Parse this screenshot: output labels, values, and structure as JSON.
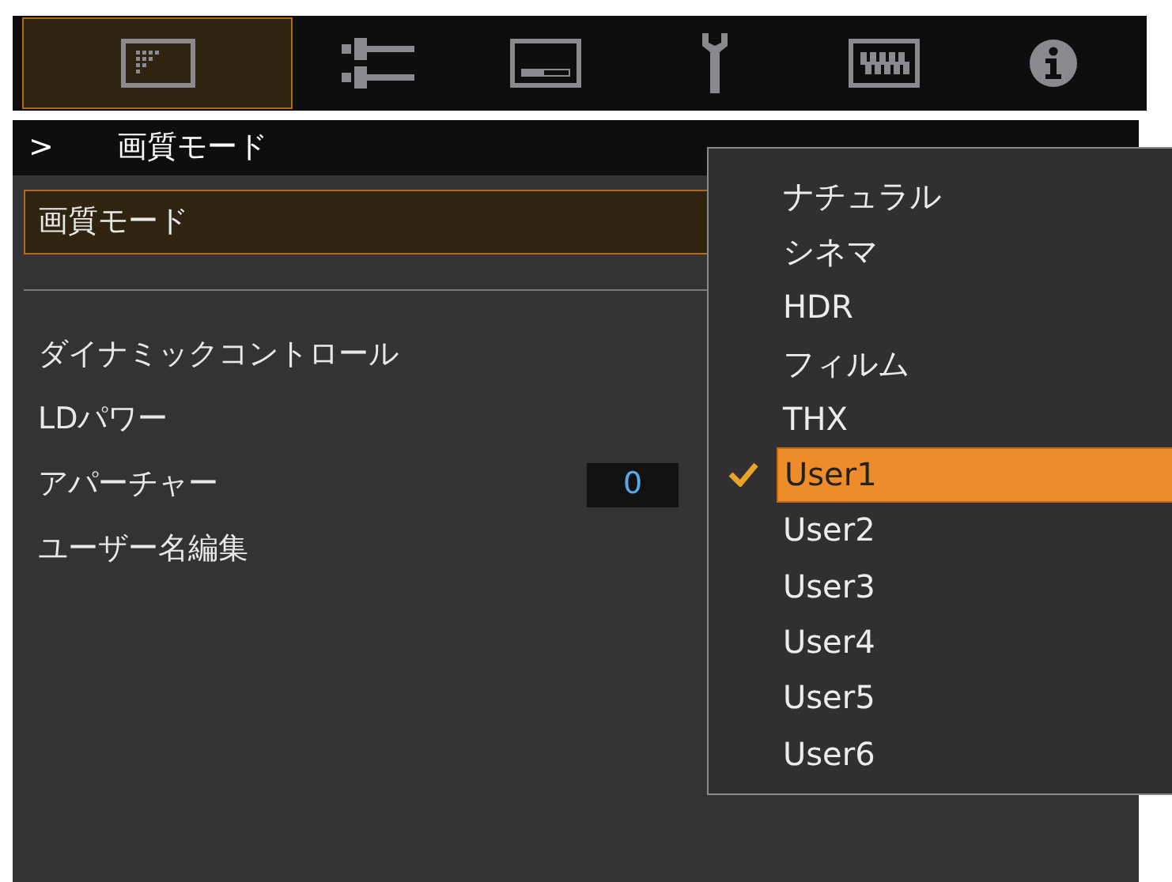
{
  "tabs": [
    {
      "selected": true
    },
    {
      "selected": false
    },
    {
      "selected": false
    },
    {
      "selected": false
    },
    {
      "selected": false
    },
    {
      "selected": false
    }
  ],
  "breadcrumb": {
    "marker": ">",
    "title": "画質モード"
  },
  "menu_groups": [
    {
      "items": [
        {
          "label": "画質モード",
          "selected": true
        }
      ]
    },
    {
      "items": [
        {
          "label": "ダイナミックコントロール",
          "selected": false
        },
        {
          "label": "LDパワー",
          "selected": false
        },
        {
          "label": "アパーチャー",
          "selected": false,
          "value": "0"
        },
        {
          "label": "ユーザー名編集",
          "selected": false
        }
      ]
    }
  ],
  "dropdown": {
    "options": [
      {
        "label": "ナチュラル",
        "selected": false
      },
      {
        "label": "シネマ",
        "selected": false
      },
      {
        "label": "HDR",
        "selected": false
      },
      {
        "label": "フィルム",
        "selected": false
      },
      {
        "label": "THX",
        "selected": false
      },
      {
        "label": "User1",
        "selected": true
      },
      {
        "label": "User2",
        "selected": false
      },
      {
        "label": "User3",
        "selected": false
      },
      {
        "label": "User4",
        "selected": false
      },
      {
        "label": "User5",
        "selected": false
      },
      {
        "label": "User6",
        "selected": false
      }
    ]
  }
}
